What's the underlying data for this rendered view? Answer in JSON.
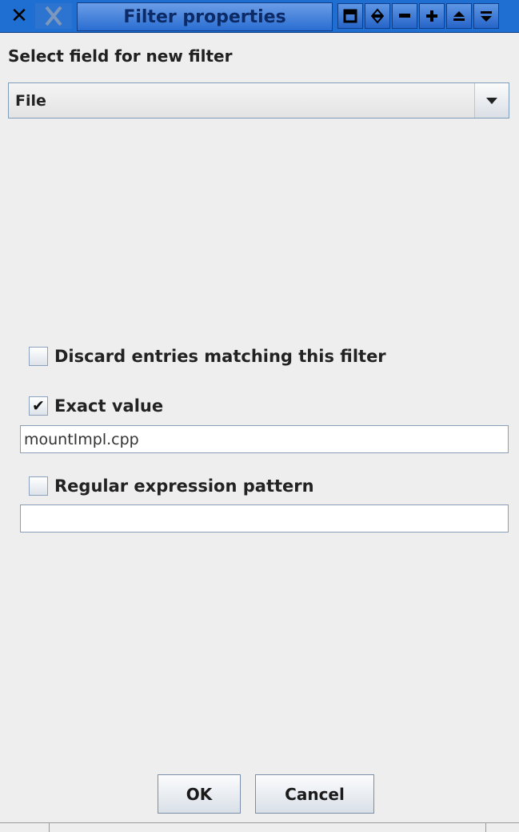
{
  "window": {
    "title": "Filter properties",
    "close_glyph": "✕",
    "icons": [
      "close-icon",
      "app-icon",
      "shade-icon",
      "sticky-icon",
      "minimize-icon",
      "maximize-icon",
      "raise-icon",
      "lower-icon"
    ]
  },
  "form": {
    "field_label": "Select field for new filter",
    "field_selected": "File",
    "discard": {
      "label": "Discard entries matching this filter",
      "checked": false
    },
    "exact": {
      "label": "Exact value",
      "checked": true,
      "check_glyph": "✔",
      "value": "mountImpl.cpp"
    },
    "regex": {
      "label": "Regular expression pattern",
      "checked": false,
      "value": ""
    }
  },
  "buttons": {
    "ok": "OK",
    "cancel": "Cancel"
  },
  "colors": {
    "titlebar": "#1e6fd1",
    "title_text": "#0b2a66",
    "background": "#eeeeee"
  }
}
